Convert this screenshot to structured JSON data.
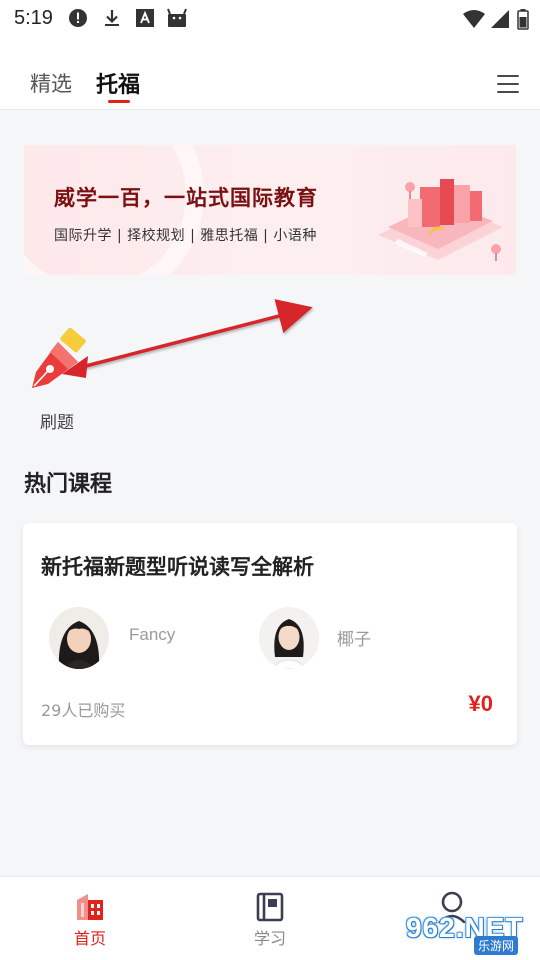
{
  "status_bar": {
    "time": "5:19",
    "icons": [
      "alert-circle-icon",
      "download-icon",
      "font-a-icon",
      "android-icon",
      "wifi-icon",
      "signal-icon",
      "battery-icon"
    ]
  },
  "tabs": [
    {
      "label": "精选",
      "active": false
    },
    {
      "label": "托福",
      "active": true
    }
  ],
  "banner": {
    "title": "威学一百，一站式国际教育",
    "subtitle": "国际升学 | 择校规划 | 雅思托福 | 小语种"
  },
  "practice": {
    "label": "刷题",
    "icon": "pen-nib-icon"
  },
  "hot_courses": {
    "title": "热门课程",
    "courses": [
      {
        "title": "新托福新题型听说读写全解析",
        "teachers": [
          {
            "name": "Fancy"
          },
          {
            "name": "椰子"
          }
        ],
        "purchased": "29人已购买",
        "price": "¥0"
      }
    ]
  },
  "bottom_nav": [
    {
      "label": "首页",
      "icon": "home-building-icon",
      "active": true
    },
    {
      "label": "学习",
      "icon": "notebook-icon",
      "active": false
    },
    {
      "label": "",
      "icon": "user-icon",
      "active": false
    }
  ],
  "watermark": {
    "text": "962.NET",
    "sub": "乐游网"
  },
  "colors": {
    "accent": "#e2231a",
    "banner_title": "#7a1012",
    "background": "#f5f6f8",
    "muted_text": "#9a9a9a"
  }
}
